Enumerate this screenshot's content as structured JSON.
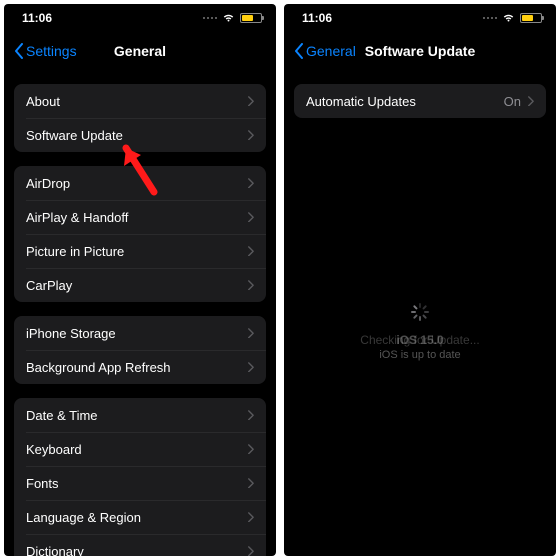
{
  "status": {
    "time": "11:06"
  },
  "left": {
    "back": "Settings",
    "title": "General",
    "groups": [
      [
        "About",
        "Software Update"
      ],
      [
        "AirDrop",
        "AirPlay & Handoff",
        "Picture in Picture",
        "CarPlay"
      ],
      [
        "iPhone Storage",
        "Background App Refresh"
      ],
      [
        "Date & Time",
        "Keyboard",
        "Fonts",
        "Language & Region",
        "Dictionary"
      ]
    ]
  },
  "right": {
    "back": "General",
    "title": "Software Update",
    "row_label": "Automatic Updates",
    "row_value": "On",
    "checking": "Checking for Update...",
    "version": "iOS 15.0",
    "uptodate": "iOS is up to date"
  }
}
